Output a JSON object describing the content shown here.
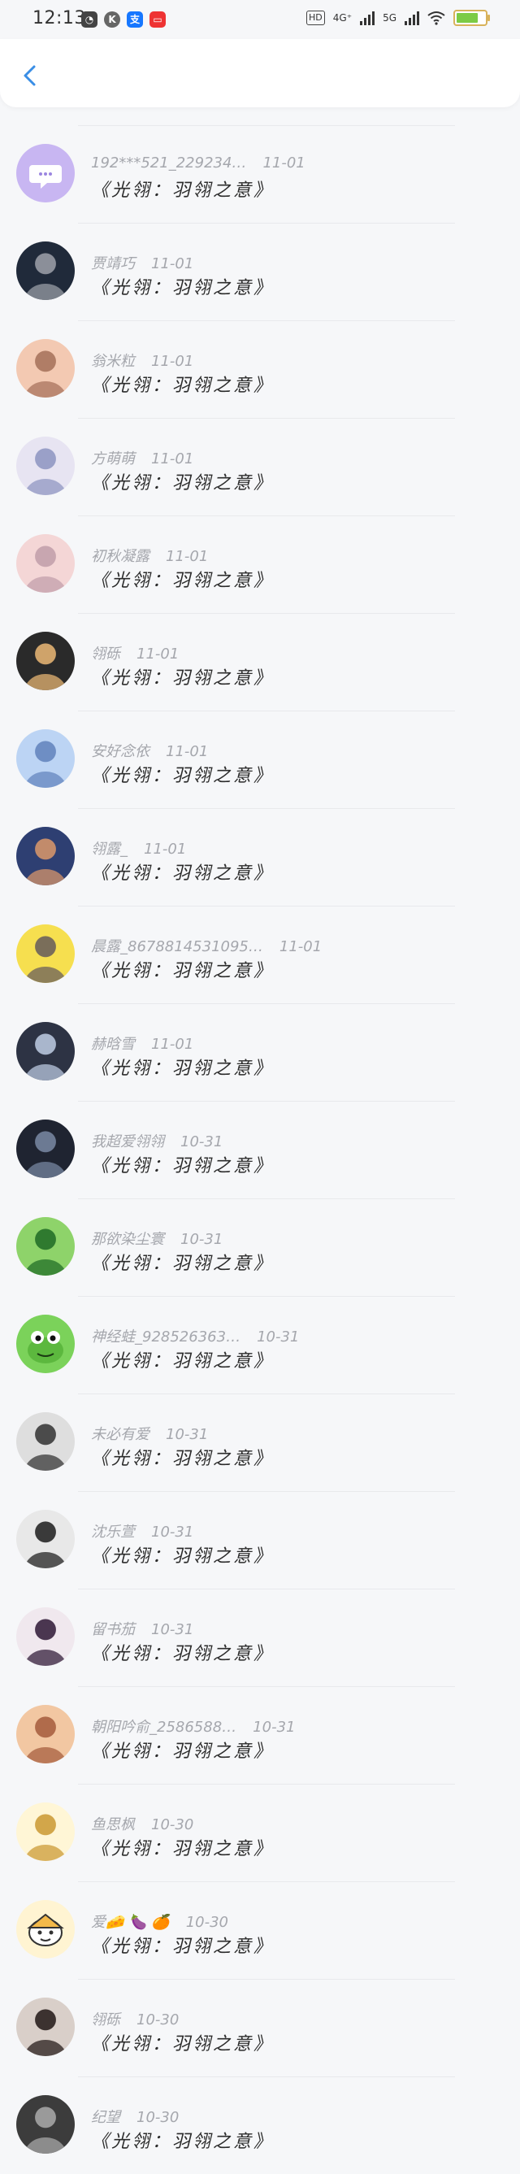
{
  "status_bar": {
    "time": "12:13",
    "network_4g": "4G⁺",
    "network_5g": "5G",
    "hd": "HD"
  },
  "comments": [
    {
      "name": "192***521_229234…",
      "date": "11-01",
      "text": "《光翎：羽翎之意》",
      "avatar": "default-avatar"
    },
    {
      "name": "贾靖巧",
      "date": "11-01",
      "text": "《光翎：羽翎之意》",
      "avatar": "photo"
    },
    {
      "name": "翁米粒",
      "date": "11-01",
      "text": "《光翎：羽翎之意》",
      "avatar": "photo"
    },
    {
      "name": "方萌萌",
      "date": "11-01",
      "text": "《光翎：羽翎之意》",
      "avatar": "photo"
    },
    {
      "name": "初秋凝露",
      "date": "11-01",
      "text": "《光翎：羽翎之意》",
      "avatar": "photo"
    },
    {
      "name": "翎砾",
      "date": "11-01",
      "text": "《光翎：羽翎之意》",
      "avatar": "photo"
    },
    {
      "name": "安好念依",
      "date": "11-01",
      "text": "《光翎：羽翎之意》",
      "avatar": "photo"
    },
    {
      "name": "翎露_",
      "date": "11-01",
      "text": "《光翎：羽翎之意》",
      "avatar": "photo"
    },
    {
      "name": "晨露_8678814531095…",
      "date": "11-01",
      "text": "《光翎：羽翎之意》",
      "avatar": "photo"
    },
    {
      "name": "赫晗雪",
      "date": "11-01",
      "text": "《光翎：羽翎之意》",
      "avatar": "photo"
    },
    {
      "name": "我超爱翎翎",
      "date": "10-31",
      "text": "《光翎：羽翎之意》",
      "avatar": "photo"
    },
    {
      "name": "那欲染尘寰",
      "date": "10-31",
      "text": "《光翎：羽翎之意》",
      "avatar": "photo"
    },
    {
      "name": "神经蛙_928526363…",
      "date": "10-31",
      "text": "《光翎：羽翎之意》",
      "avatar": "frog"
    },
    {
      "name": "未必有爱",
      "date": "10-31",
      "text": "《光翎：羽翎之意》",
      "avatar": "photo"
    },
    {
      "name": "沈乐萱",
      "date": "10-31",
      "text": "《光翎：羽翎之意》",
      "avatar": "photo"
    },
    {
      "name": "留书茄",
      "date": "10-31",
      "text": "《光翎：羽翎之意》",
      "avatar": "photo"
    },
    {
      "name": "朝阳吟俞_2586588…",
      "date": "10-31",
      "text": "《光翎：羽翎之意》",
      "avatar": "photo"
    },
    {
      "name": "鱼思枫",
      "date": "10-30",
      "text": "《光翎：羽翎之意》",
      "avatar": "photo"
    },
    {
      "name": "爱🧀 🍆 🍊",
      "date": "10-30",
      "text": "《光翎：羽翎之意》",
      "avatar": "cartoon"
    },
    {
      "name": "翎砾",
      "date": "10-30",
      "text": "《光翎：羽翎之意》",
      "avatar": "photo"
    },
    {
      "name": "纪望",
      "date": "10-30",
      "text": "《光翎：羽翎之意》",
      "avatar": "photo"
    }
  ],
  "colors": {
    "accent": "#3a8ee6",
    "background": "#f6f7f9",
    "meta_text": "#a5a7ad"
  }
}
